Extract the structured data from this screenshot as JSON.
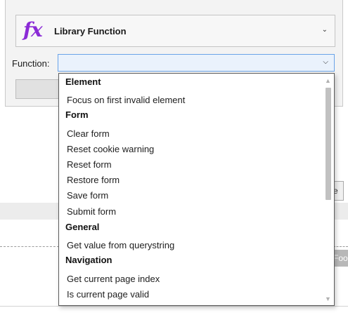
{
  "function_type": {
    "icon": "function-fx-icon",
    "icon_glyph": "fx",
    "label": "Library Function",
    "accent_color": "#8b2bd6"
  },
  "function_field": {
    "label": "Function:",
    "value": ""
  },
  "dropdown": {
    "groups": [
      {
        "title": "Element",
        "items": [
          "Focus on first invalid element"
        ]
      },
      {
        "title": "Form",
        "items": [
          "Clear form",
          "Reset cookie warning",
          "Reset form",
          "Restore form",
          "Save form",
          "Submit form"
        ]
      },
      {
        "title": "General",
        "items": [
          "Get value from querystring"
        ]
      },
      {
        "title": "Navigation",
        "items": [
          "Get current page index",
          "Is current page valid"
        ]
      }
    ]
  },
  "background": {
    "foo_tag": "Foo"
  }
}
